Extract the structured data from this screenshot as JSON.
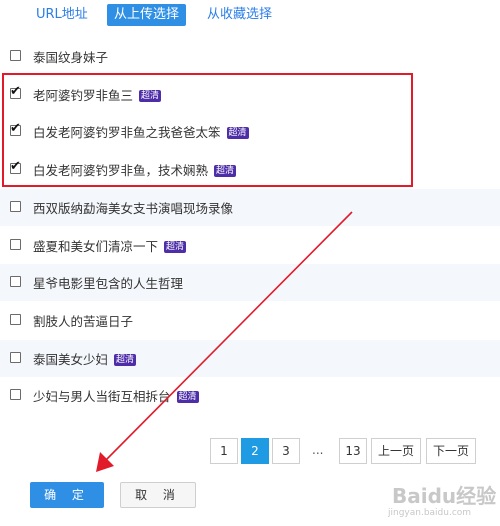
{
  "tabs": [
    {
      "label": "URL地址",
      "active": false
    },
    {
      "label": "从上传选择",
      "active": true
    },
    {
      "label": "从收藏选择",
      "active": false
    }
  ],
  "videos": [
    {
      "title": "泰国纹身妹子",
      "badge": "",
      "checked": false
    },
    {
      "title": "老阿婆钓罗非鱼三",
      "badge": "超清",
      "checked": true
    },
    {
      "title": "白发老阿婆钓罗非鱼之我爸爸太笨",
      "badge": "超清",
      "checked": true
    },
    {
      "title": "白发老阿婆钓罗非鱼，技术娴熟",
      "badge": "超清",
      "checked": true
    },
    {
      "title": "西双版纳勐海美女支书演唱现场录像",
      "badge": "",
      "checked": false
    },
    {
      "title": "盛夏和美女们清凉一下",
      "badge": "超清",
      "checked": false
    },
    {
      "title": "星爷电影里包含的人生哲理",
      "badge": "",
      "checked": false
    },
    {
      "title": "割肢人的苦逼日子",
      "badge": "",
      "checked": false
    },
    {
      "title": "泰国美女少妇",
      "badge": "超清",
      "checked": false
    },
    {
      "title": "少妇与男人当街互相拆台",
      "badge": "超清",
      "checked": false
    }
  ],
  "pagination": {
    "pages": [
      "1",
      "2",
      "3"
    ],
    "current": "2",
    "ellipsis": "...",
    "last": "13",
    "prev_label": "上一页",
    "next_label": "下一页"
  },
  "actions": {
    "ok_label": "确 定",
    "cancel_label": "取 消"
  },
  "watermark": {
    "text": "Baidu经验",
    "sub": "jingyan.baidu.com"
  },
  "colors": {
    "accent": "#2f8fe5",
    "highlight_box": "#e11b2a",
    "badge": "#4e2ea8"
  }
}
